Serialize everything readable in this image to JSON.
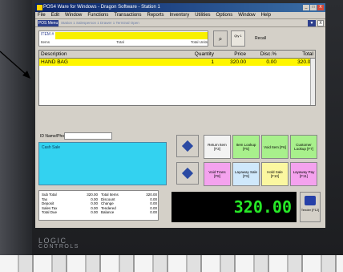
{
  "window": {
    "title": "POS4 Ware for Windows - Dragon Software - Station 1",
    "controls": [
      "_",
      "□",
      "X"
    ]
  },
  "menu": [
    "File",
    "Edit",
    "Window",
    "Functions",
    "Transactions",
    "Reports",
    "Inventory",
    "Utilities",
    "Options",
    "Window",
    "Help"
  ],
  "toolbar": {
    "menu_button": "POS Menu",
    "info": "Station 1  Salesperson 1  Drawer 1  Terminal Open",
    "drop": "▼",
    "close": "X"
  },
  "entry": {
    "label": "ITEM #",
    "sub_left": "Items",
    "sub_mid": "Total",
    "sub_right": "Total Units"
  },
  "buttons": {
    "find_icon": "binoculars-icon",
    "find_glyph": "⌕",
    "qty_label": "Qty 1",
    "recall_label": "Recall"
  },
  "grid": {
    "columns": [
      "Description",
      "Quantity",
      "Price",
      "Disc.%",
      "Total"
    ],
    "rows": [
      {
        "description": "HAND BAG",
        "quantity": "1",
        "price": "320.00",
        "discount": "0.00",
        "total": "320.00"
      }
    ]
  },
  "customer": {
    "label": "ID Name/Phone",
    "name": "Cash Sale"
  },
  "keys": {
    "k1": "Return Item [F3]",
    "k2": "Item Lookup [F5]",
    "k3": "Void Item [F6]",
    "k4": "Customer Lookup [F7]",
    "k5": "Void Trans [F8]",
    "k6": "Layaway Sale [F9]",
    "k7": "Hold Sale [F10]",
    "k8": "Layaway Pay [F11]"
  },
  "totals": {
    "left": [
      {
        "label": "Sub Total",
        "value": "320.00"
      },
      {
        "label": "Tax",
        "value": "0.00"
      },
      {
        "label": "Deposit",
        "value": "0.00"
      },
      {
        "label": "Sales Tax",
        "value": "0.00"
      },
      {
        "label": "Total Due",
        "value": "0.00"
      }
    ],
    "right": [
      {
        "label": "Total Items",
        "value": "320.00"
      },
      {
        "label": "Discount",
        "value": "0.00"
      },
      {
        "label": "Change",
        "value": "0.00"
      },
      {
        "label": "Tendered",
        "value": "0.00"
      },
      {
        "label": "Balance",
        "value": "0.00"
      }
    ]
  },
  "grand_total": "320.00",
  "tender": {
    "label": "Tender [F12]",
    "icon": "cash-register-icon"
  },
  "monitor": {
    "brand_line1": "LOGIC",
    "brand_line2": "CONTROLS"
  },
  "colors": {
    "yellow": "#fff600",
    "cyan": "#33d2f0",
    "green_key": "#a8f08c",
    "pink_key": "#f4a2ee",
    "display_text": "#26e826",
    "title_bar": "#0a246a"
  }
}
